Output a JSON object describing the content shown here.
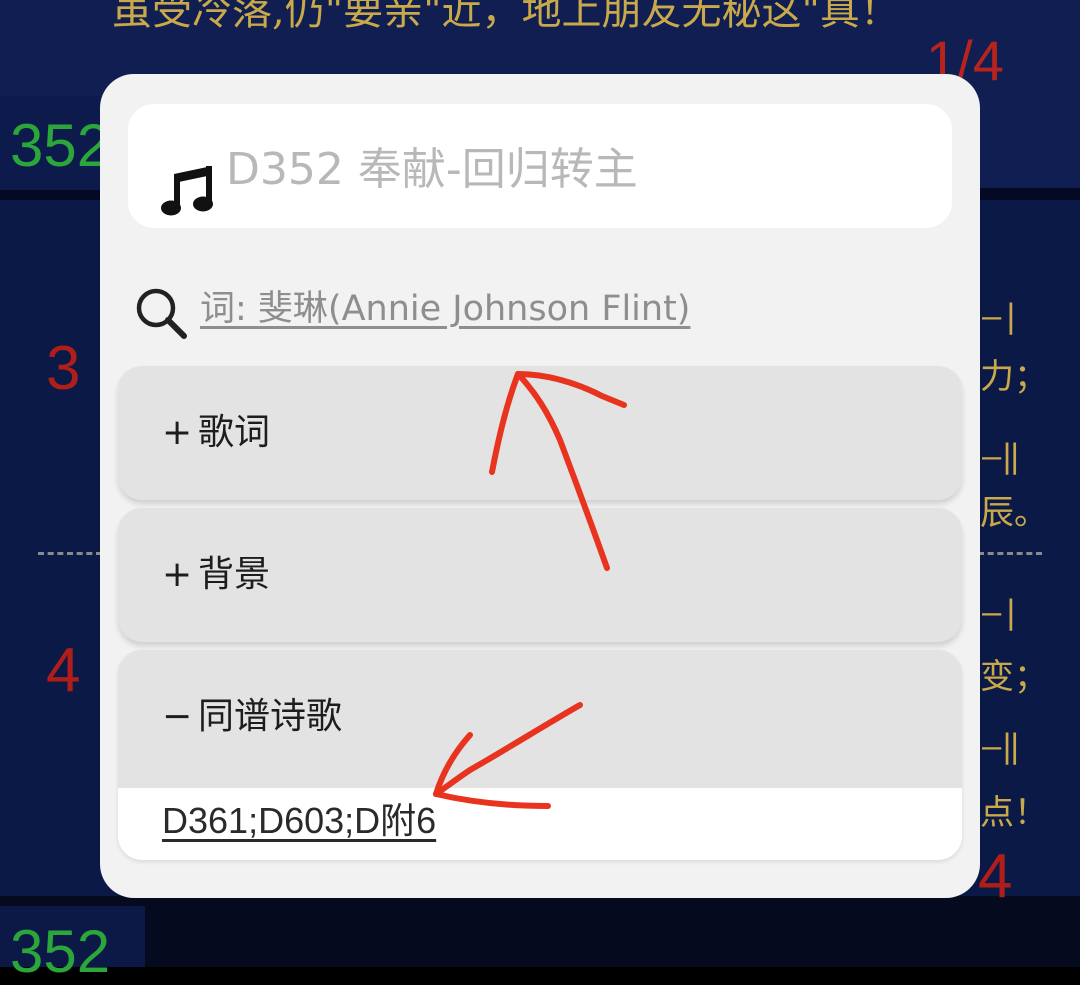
{
  "background": {
    "top_lyric": "虽受冷落,仍\"要亲\"近，地上朋友无秘这\"真！",
    "page_indicator": "1/4",
    "hymn_number": "352",
    "verse_numbers": [
      "3",
      "4"
    ],
    "page_indicator_partial": "4",
    "right_column_chars": [
      "力；",
      "辰。",
      "变；",
      "点！"
    ],
    "bar_marks": [
      "—|",
      "—‖",
      "—|",
      "—‖"
    ]
  },
  "popup": {
    "title": "D352 奉献-回归转主",
    "title_icon": "music-note-icon",
    "author_icon": "search-icon",
    "author_link": "词: 斐琳(Annie Johnson Flint)",
    "sections": [
      {
        "sign": "+",
        "label": "歌词",
        "expanded": false
      },
      {
        "sign": "+",
        "label": "背景",
        "expanded": false
      },
      {
        "sign": "−",
        "label": "同谱诗歌",
        "expanded": true,
        "content": "D361;D603;D附6"
      }
    ]
  },
  "colors": {
    "popup_bg": "#f2f2f2",
    "section_bg": "#e3e3e3",
    "annotation_red": "#e8331e",
    "app_bg": "#0b1947"
  }
}
